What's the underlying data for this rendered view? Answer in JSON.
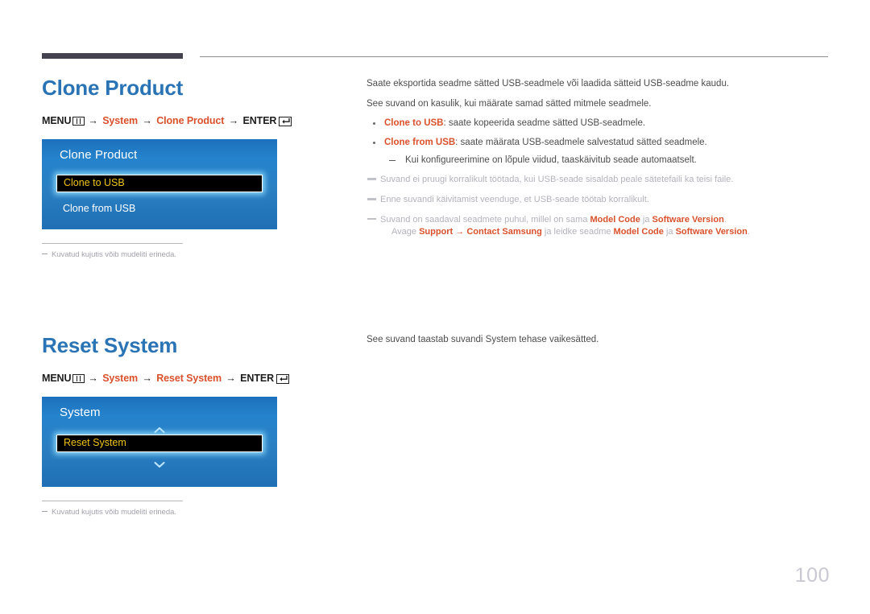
{
  "page": {
    "number": "100"
  },
  "sections": [
    {
      "title": "Clone Product",
      "menu_path": {
        "menu_label": "MENU",
        "menu_icon": "menu-grid-icon",
        "arrow": "→",
        "step1": "System",
        "step2": "Clone Product",
        "enter_label": "ENTER",
        "enter_icon": "enter-return-icon"
      },
      "osd": {
        "title": "Clone Product",
        "rows": [
          {
            "label": "Clone to USB",
            "selected": true
          },
          {
            "label": "Clone from USB",
            "selected": false
          }
        ],
        "chevron_up": false,
        "chevron_down": false
      },
      "note": "Kuvatud kujutis võib mudeliti erineda.",
      "body": {
        "paragraphs": [
          "Saate eksportida seadme sätted USB-seadmele või laadida sätteid USB-seadme kaudu.",
          "See suvand on kasulik, kui määrate samad sätted mitmele seadmele."
        ],
        "bullets": [
          {
            "term": "Clone to USB",
            "text": ": saate kopeerida seadme sätted USB-seadmele."
          },
          {
            "term": "Clone from USB",
            "text": ": saate määrata USB-seadmele salvestatud sätted seadmele.",
            "sub": "Kui konfigureerimine on lõpule viidud, taaskäivitub seade automaatselt."
          }
        ],
        "gray_notes": [
          {
            "text": "Suvand ei pruugi korralikult töötada, kui USB-seade sisaldab peale sätetefaili ka teisi faile."
          },
          {
            "text": "Enne suvandi käivitamist veenduge, et USB-seade töötab korralikult."
          },
          {
            "line1_a": "Suvand on saadaval seadmete puhul, millel on sama ",
            "line1_b1": "Model Code",
            "line1_c": " ja ",
            "line1_b2": "Software Version",
            "line1_d": ".",
            "line2_a": "Avage ",
            "line2_b1": "Support",
            "line2_arrow": " → ",
            "line2_b2": "Contact Samsung",
            "line2_c": " ja leidke seadme ",
            "line2_b3": "Model Code",
            "line2_d": " ja ",
            "line2_b4": "Software Version",
            "line2_e": "."
          }
        ]
      }
    },
    {
      "title": "Reset System",
      "menu_path": {
        "menu_label": "MENU",
        "menu_icon": "menu-grid-icon",
        "arrow": "→",
        "step1": "System",
        "step2": "Reset System",
        "enter_label": "ENTER",
        "enter_icon": "enter-return-icon"
      },
      "osd": {
        "title": "System",
        "rows": [
          {
            "label": "Reset System",
            "selected": true
          }
        ],
        "chevron_up": true,
        "chevron_down": true
      },
      "note": "Kuvatud kujutis võib mudeliti erineda.",
      "body": {
        "paragraphs": [
          "See suvand taastab suvandi System tehase vaikesätted."
        ]
      }
    }
  ],
  "colors": {
    "heading_blue": "#2a74b5",
    "accent_orange": "#d9512c",
    "osd_blue": "#2a7fc2",
    "osd_selected_text": "#f0c419",
    "gray_note": "#b3b3bb",
    "header_bar": "#45424f"
  }
}
